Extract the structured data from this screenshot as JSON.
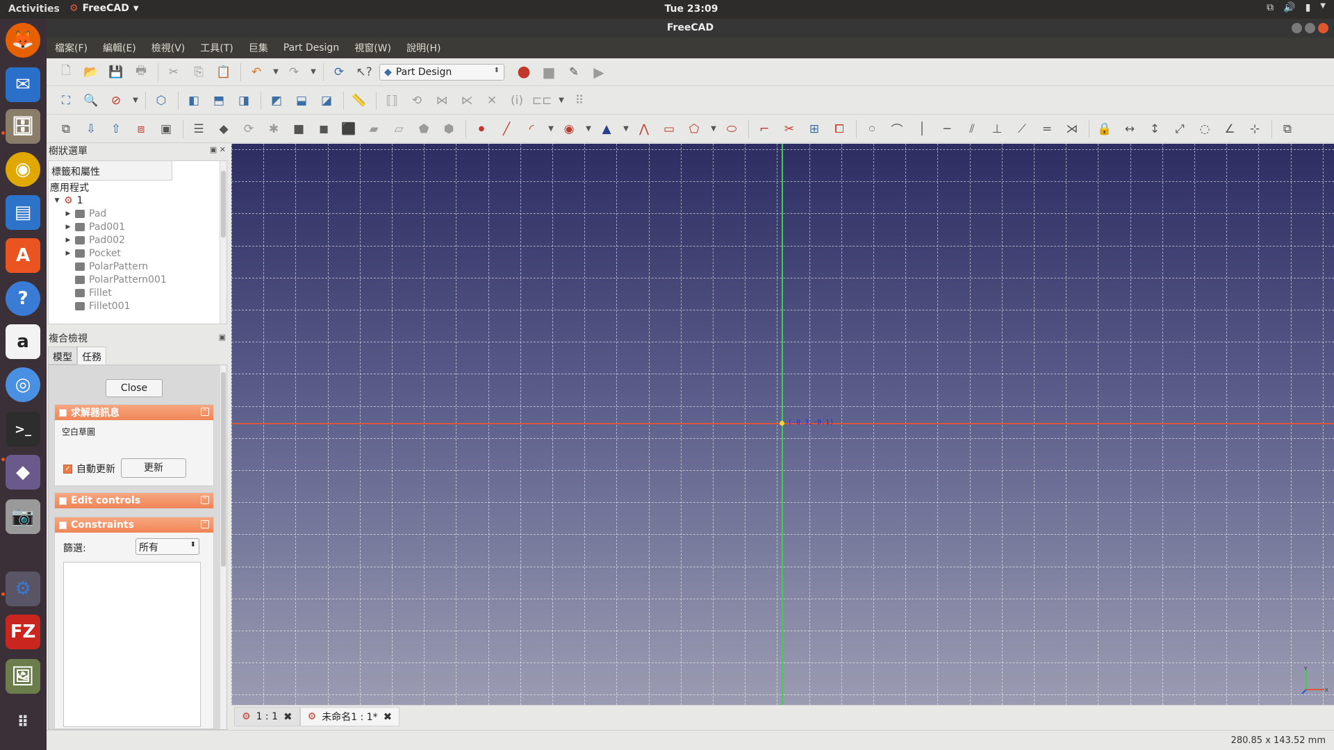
{
  "topbar": {
    "activities": "Activities",
    "app_name": "FreeCAD",
    "clock": "Tue 23:09"
  },
  "window": {
    "title": "FreeCAD"
  },
  "menu": [
    "檔案(F)",
    "編輯(E)",
    "檢視(V)",
    "工具(T)",
    "巨集",
    "Part Design",
    "視窗(W)",
    "說明(H)"
  ],
  "toolbar": {
    "workbench": "Part Design"
  },
  "tree_panel": {
    "title": "樹狀選單",
    "header": "標籤和屬性",
    "section": "應用程式",
    "document": "1",
    "items": [
      {
        "label": "Pad",
        "expandable": true
      },
      {
        "label": "Pad001",
        "expandable": true
      },
      {
        "label": "Pad002",
        "expandable": true
      },
      {
        "label": "Pocket",
        "expandable": true
      },
      {
        "label": "PolarPattern",
        "expandable": false
      },
      {
        "label": "PolarPattern001",
        "expandable": false
      },
      {
        "label": "Fillet",
        "expandable": false
      },
      {
        "label": "Fillet001",
        "expandable": false
      }
    ]
  },
  "combo_view": {
    "title": "複合檢視",
    "tabs": [
      "模型",
      "任務"
    ],
    "active_tab": "任務",
    "close_label": "Close",
    "solver": {
      "title": "求解器訊息",
      "message": "空白草圖",
      "auto_update_label": "自動更新",
      "auto_update_checked": true,
      "update_label": "更新"
    },
    "edit_controls": {
      "title": "Edit controls"
    },
    "constraints": {
      "title": "Constraints",
      "filter_label": "篩選:",
      "filter_value": "所有"
    }
  },
  "viewport": {
    "cursor_coord": "(-0.3,-0.1)",
    "axis_colors": {
      "x": "#d7583a",
      "y": "#3ad24b"
    },
    "background_top": "#2d2d62",
    "background_bottom": "#9b9cb2"
  },
  "doc_tabs": [
    {
      "label": "1 : 1",
      "active": false
    },
    {
      "label": "未命名1 : 1*",
      "active": true
    }
  ],
  "status": {
    "dimensions": "280.85 x 143.52 mm"
  }
}
